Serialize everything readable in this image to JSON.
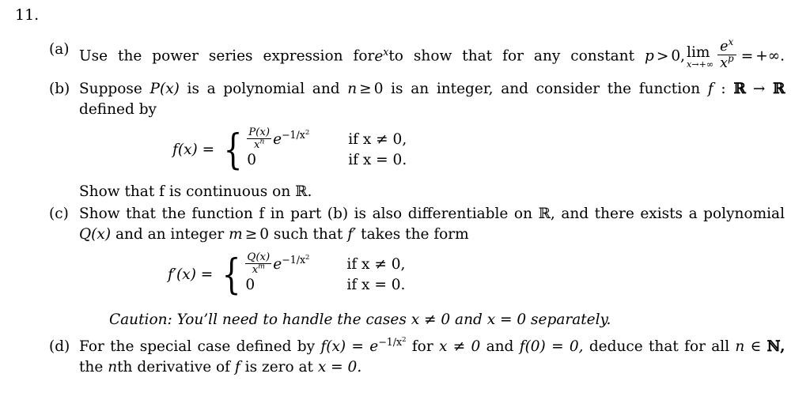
{
  "document": {
    "problem_number": "11.",
    "type": "math-exercise"
  },
  "parts": {
    "a": {
      "label": "(a)",
      "text_1": "Use the power series expression for",
      "math_e_base": "e",
      "math_e_exp": "x",
      "text_2": "to show that for any constant",
      "math_p": "p",
      "math_gt": ">",
      "math_zero": "0,",
      "lim_name": "lim",
      "lim_sub": "x→+∞",
      "frac_num_base": "e",
      "frac_num_exp": "x",
      "frac_den_base": "x",
      "frac_den_exp": "p",
      "equals": "=",
      "result": "+∞."
    },
    "b": {
      "label": "(b)",
      "line_1_a": "Suppose",
      "math_P": "P(x)",
      "line_1_b": "is a polynomial and",
      "math_n": "n",
      "math_geq": "≥",
      "math_zero": "0",
      "line_1_c": "is an integer, and consider the function",
      "math_f": "f",
      "colon": ":",
      "math_R1": "ℝ",
      "arrow": "→",
      "math_R2": "ℝ",
      "line_2": "defined by",
      "equation": {
        "lhs": "f(x) =",
        "case1_num": "P(x)",
        "case1_den": "x",
        "case1_den_exp": "n",
        "case1_e": "e",
        "case1_e_exp": "−1/x",
        "case1_e_exp_sq": "2",
        "case1_cond": "if x ≠ 0,",
        "case2_expr": "0",
        "case2_cond": "if x = 0."
      },
      "closing": "Show that f is continuous on ℝ."
    },
    "c": {
      "label": "(c)",
      "line_1": "Show that the function f in part (b) is also differentiable on ℝ, and there exists a polynomial",
      "line_2_a": "Q(x)",
      "line_2_b": "and an integer",
      "math_m": "m",
      "math_geq": "≥",
      "math_zero": "0",
      "line_2_c": "such that",
      "math_fprime": "f′",
      "line_2_d": "takes the form",
      "equation": {
        "lhs": "f′(x) =",
        "case1_num": "Q(x)",
        "case1_den": "x",
        "case1_den_exp": "m",
        "case1_e": "e",
        "case1_e_exp": "−1/x",
        "case1_e_exp_sq": "2",
        "case1_cond": "if x ≠ 0,",
        "case2_expr": "0",
        "case2_cond": "if x = 0."
      },
      "caution": "Caution: You’ll need to handle the cases x ≠ 0 and x = 0 separately."
    },
    "d": {
      "label": "(d)",
      "line_1_a": "For the special case defined by",
      "math_fx": "f(x) =",
      "math_e": "e",
      "math_e_exp": "−1/x",
      "math_e_exp_sq": "2",
      "line_1_b": "for",
      "math_x_neq": "x ≠ 0",
      "line_1_c": "and",
      "math_f0": "f(0) = 0,",
      "line_1_d": "deduce that for all",
      "math_n": "n",
      "math_in": "∈",
      "math_N": "ℕ,",
      "line_2_a": "the",
      "math_nth": "n",
      "line_2_b": "th derivative of",
      "math_f": "f",
      "line_2_c": "is zero at",
      "math_x0": "x = 0."
    }
  },
  "colors": {
    "background": "#ffffff",
    "text": "#000000"
  }
}
